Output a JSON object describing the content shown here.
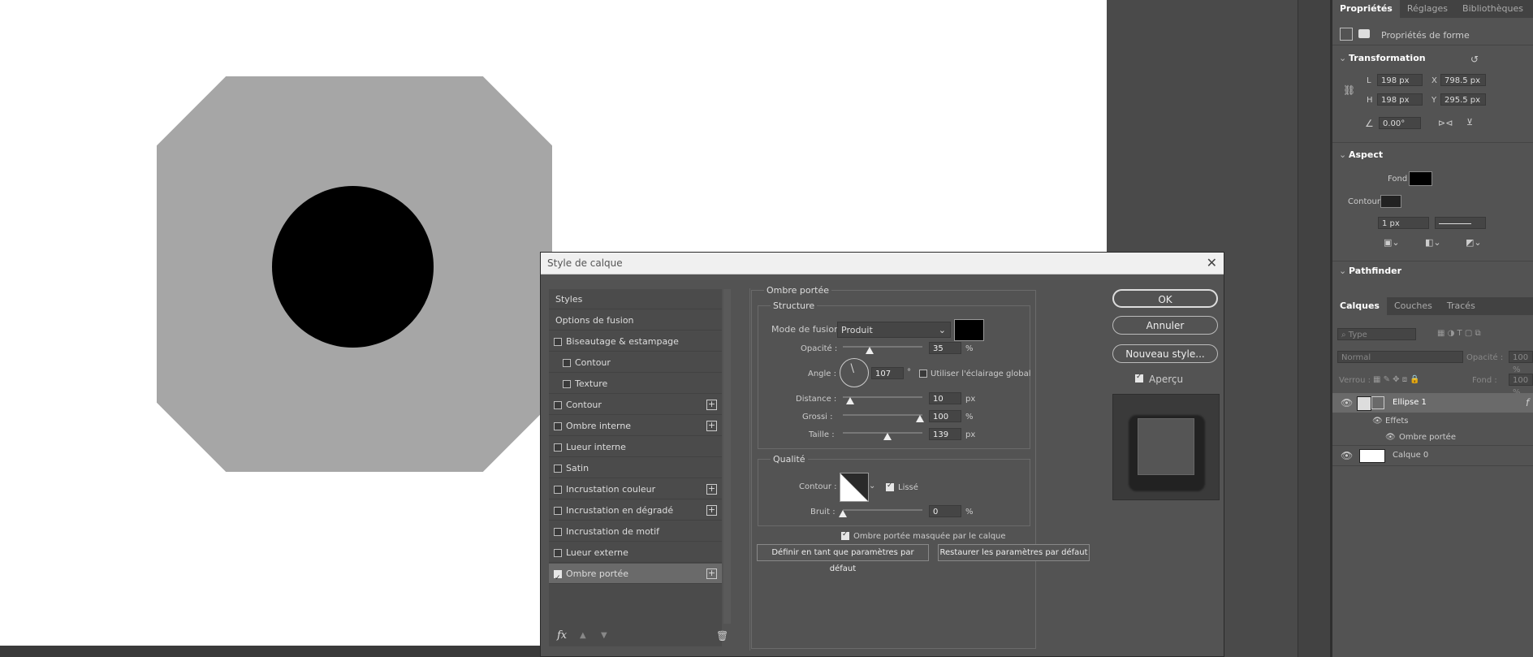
{
  "dialog": {
    "title": "Style de calque",
    "styles_header": "Styles",
    "options_fusion": "Options de fusion",
    "style_items": [
      {
        "label": "Biseautage & estampage",
        "checked": false,
        "plus": false,
        "indent": false
      },
      {
        "label": "Contour",
        "checked": false,
        "plus": false,
        "indent": true
      },
      {
        "label": "Texture",
        "checked": false,
        "plus": false,
        "indent": true
      },
      {
        "label": "Contour",
        "checked": false,
        "plus": true,
        "indent": false
      },
      {
        "label": "Ombre interne",
        "checked": false,
        "plus": true,
        "indent": false
      },
      {
        "label": "Lueur interne",
        "checked": false,
        "plus": false,
        "indent": false
      },
      {
        "label": "Satin",
        "checked": false,
        "plus": false,
        "indent": false
      },
      {
        "label": "Incrustation couleur",
        "checked": false,
        "plus": true,
        "indent": false
      },
      {
        "label": "Incrustation en dégradé",
        "checked": false,
        "plus": true,
        "indent": false
      },
      {
        "label": "Incrustation de motif",
        "checked": false,
        "plus": false,
        "indent": false
      },
      {
        "label": "Lueur externe",
        "checked": false,
        "plus": false,
        "indent": false
      },
      {
        "label": "Ombre portée",
        "checked": true,
        "plus": true,
        "indent": false,
        "selected": true
      }
    ],
    "fx_label": "fx",
    "section_title": "Ombre portée",
    "structure_title": "Structure",
    "blend_mode_label": "Mode de fusion :",
    "blend_mode_value": "Produit",
    "shadow_color": "#000000",
    "opacity_label": "Opacité :",
    "opacity_value": "35",
    "opacity_unit": "%",
    "angle_label": "Angle :",
    "angle_value": "107",
    "angle_unit": "°",
    "global_light_label": "Utiliser l'éclairage global",
    "distance_label": "Distance :",
    "distance_value": "10",
    "distance_unit": "px",
    "spread_label": "Grossi :",
    "spread_value": "100",
    "spread_unit": "%",
    "size_label": "Taille :",
    "size_value": "139",
    "size_unit": "px",
    "quality_title": "Qualité",
    "contour_label": "Contour :",
    "antialias_label": "Lissé",
    "noise_label": "Bruit :",
    "noise_value": "0",
    "noise_unit": "%",
    "knockout_label": "Ombre portée masquée par le calque",
    "set_default_label": "Définir en tant que paramètres par défaut",
    "reset_default_label": "Restaurer les paramètres par défaut",
    "ok_label": "OK",
    "cancel_label": "Annuler",
    "new_style_label": "Nouveau style...",
    "preview_label": "Aperçu"
  },
  "properties": {
    "tabs": [
      "Propriétés",
      "Réglages",
      "Bibliothèques"
    ],
    "shape_props_label": "Propriétés de forme",
    "transformation_title": "Transformation",
    "w_label": "L",
    "w_value": "198 px",
    "x_label": "X",
    "x_value": "798.5 px",
    "h_label": "H",
    "h_value": "198 px",
    "y_label": "Y",
    "y_value": "295.5 px",
    "angle_value": "0.00°",
    "aspect_title": "Aspect",
    "fill_label": "Fond",
    "stroke_label": "Contour",
    "stroke_width": "1 px",
    "pathfinder_title": "Pathfinder"
  },
  "layers": {
    "tabs": [
      "Calques",
      "Couches",
      "Tracés"
    ],
    "search_placeholder": "Type",
    "blend_mode": "Normal",
    "opacity_label": "Opacité :",
    "opacity_value": "100 %",
    "lock_label": "Verrou :",
    "fill_label": "Fond :",
    "fill_value": "100 %",
    "items": [
      {
        "name": "Ellipse 1",
        "selected": true
      },
      {
        "name": "Effets"
      },
      {
        "name": "Ombre portée"
      },
      {
        "name": "Calque 0"
      }
    ]
  },
  "colors": {
    "octagon": "#a6a6a6",
    "ellipse": "#000000",
    "accent": "#ffffff"
  }
}
